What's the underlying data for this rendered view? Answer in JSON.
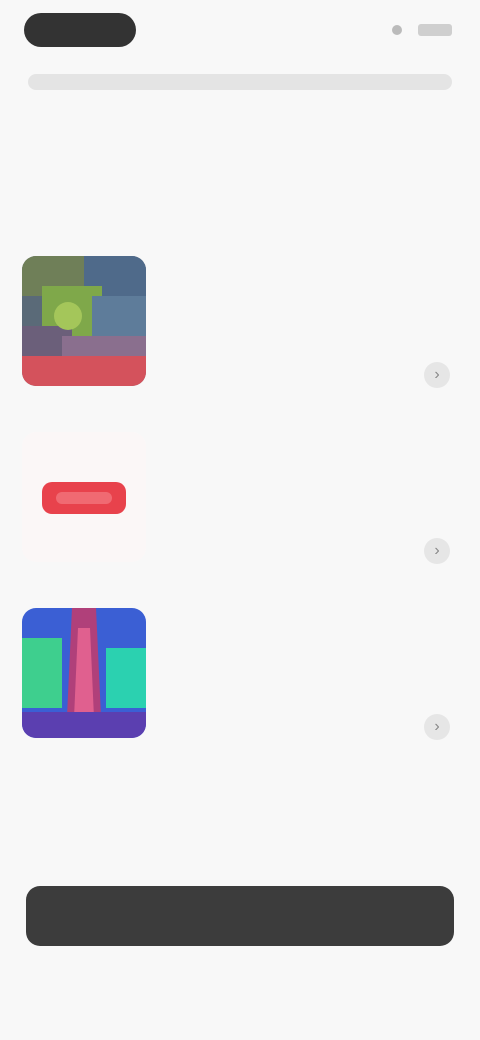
{
  "status_bar": {
    "pill_label": "",
    "right_label": ""
  },
  "heading": {
    "title": "",
    "subtitle": ""
  },
  "apps": [
    {
      "title": "",
      "description": "",
      "icon": "mosaic-thumbnail-icon",
      "chevron": "›"
    },
    {
      "title": "",
      "description": "",
      "icon": "red-logo-icon",
      "chevron": "›"
    },
    {
      "title": "",
      "description": "",
      "icon": "colorful-art-thumbnail-icon",
      "chevron": "›"
    }
  ],
  "footer": {
    "button_label": ""
  },
  "colors": {
    "background": "#f8f8f8",
    "button": "#3c3c3c",
    "heading": "#3a3a3a",
    "muted": "#9a9a9a",
    "accent_red": "#e8424c"
  }
}
